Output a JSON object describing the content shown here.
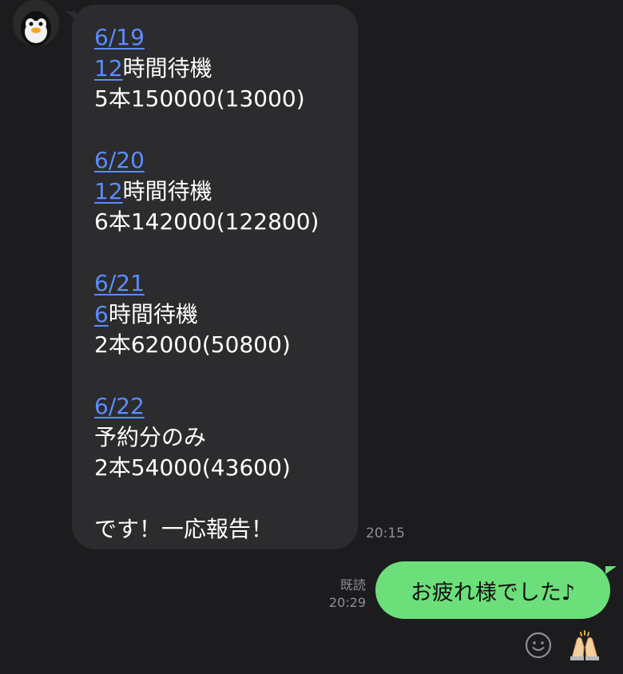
{
  "messages": {
    "incoming": {
      "sections": [
        {
          "date": "6/19",
          "line2_num": "12",
          "line2_text": "時間待機",
          "line3": "5本150000(13000)"
        },
        {
          "date": "6/20",
          "line2_num": "12",
          "line2_text": "時間待機",
          "line3": "6本142000(122800)"
        },
        {
          "date": "6/21",
          "line2_num": "6",
          "line2_text": "時間待機",
          "line3": "2本62000(50800)"
        },
        {
          "date": "6/22",
          "line2_text": "予約分のみ",
          "line3": "2本54000(43600)"
        }
      ],
      "closing": "です！一応報告！",
      "time": "20:15"
    },
    "outgoing": {
      "text": "お疲れ様でした♪",
      "read_label": "既読",
      "time": "20:29"
    }
  },
  "icons": {
    "avatar": "penguin-avatar-icon",
    "reaction": "smiley-face-icon",
    "sticker": "clapping-hands-icon"
  },
  "colors": {
    "background": "#1c1c1e",
    "incoming_bubble": "#2c2c2e",
    "outgoing_bubble": "#6cdf7a",
    "link": "#5b8dff",
    "meta_text": "#8e8e93"
  }
}
